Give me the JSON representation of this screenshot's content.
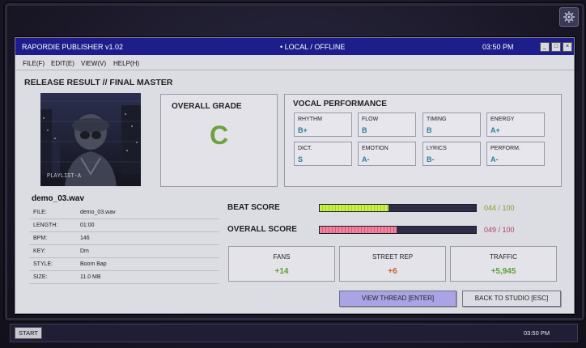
{
  "window": {
    "title": "RAPORDIE PUBLISHER v1.02",
    "status": "• LOCAL / OFFLINE",
    "time": "03:50 PM",
    "controls": [
      "minimize-icon",
      "maximize-icon",
      "close-icon"
    ]
  },
  "menu": [
    "FILE(F)",
    "EDIT(E)",
    "VIEW(V)",
    "HELP(H)"
  ],
  "heading": "RELEASE RESULT // FINAL MASTER",
  "cover": {
    "caption": "PLAYLIST-A"
  },
  "grade": {
    "label": "OVERALL GRADE",
    "value": "C",
    "color": "#6aa33a"
  },
  "vocal": {
    "label": "VOCAL PERFORMANCE",
    "stats": [
      {
        "label": "RHYTHM",
        "value": "B+"
      },
      {
        "label": "FLOW",
        "value": "B"
      },
      {
        "label": "TIMING",
        "value": "B"
      },
      {
        "label": "ENERGY",
        "value": "A+"
      },
      {
        "label": "DICT.",
        "value": "S"
      },
      {
        "label": "EMOTION",
        "value": "A-"
      },
      {
        "label": "LYRICS",
        "value": "B-"
      },
      {
        "label": "PERFORM.",
        "value": "A-"
      }
    ]
  },
  "file": {
    "name": "demo_03.wav",
    "rows": [
      {
        "key": "FILE:",
        "value": "demo_03.wav"
      },
      {
        "key": "LENGTH:",
        "value": "01:00"
      },
      {
        "key": "BPM:",
        "value": "146"
      },
      {
        "key": "KEY:",
        "value": "Dm"
      },
      {
        "key": "STYLE:",
        "value": "Boom Bap"
      },
      {
        "key": "SIZE:",
        "value": "11.0 MB"
      }
    ]
  },
  "scores": {
    "beat": {
      "label": "BEAT SCORE",
      "text": "044 / 100",
      "value": 44,
      "color": "#8a9a2a"
    },
    "overall": {
      "label": "OVERALL SCORE",
      "text": "049 / 100",
      "value": 49,
      "color": "#b0405e"
    }
  },
  "metrics": [
    {
      "label": "FANS",
      "value": "+14",
      "color": "#5f9e36"
    },
    {
      "label": "STREET REP",
      "value": "+6",
      "color": "#c2642a"
    },
    {
      "label": "TRAFFIC",
      "value": "+5,945",
      "color": "#5f9e36"
    }
  ],
  "buttons": {
    "view_thread": "VIEW THREAD [ENTER]",
    "back_to_studio": "BACK TO STUDIO [ESC]"
  },
  "taskbar": {
    "start": "START",
    "time": "03:50 PM"
  }
}
